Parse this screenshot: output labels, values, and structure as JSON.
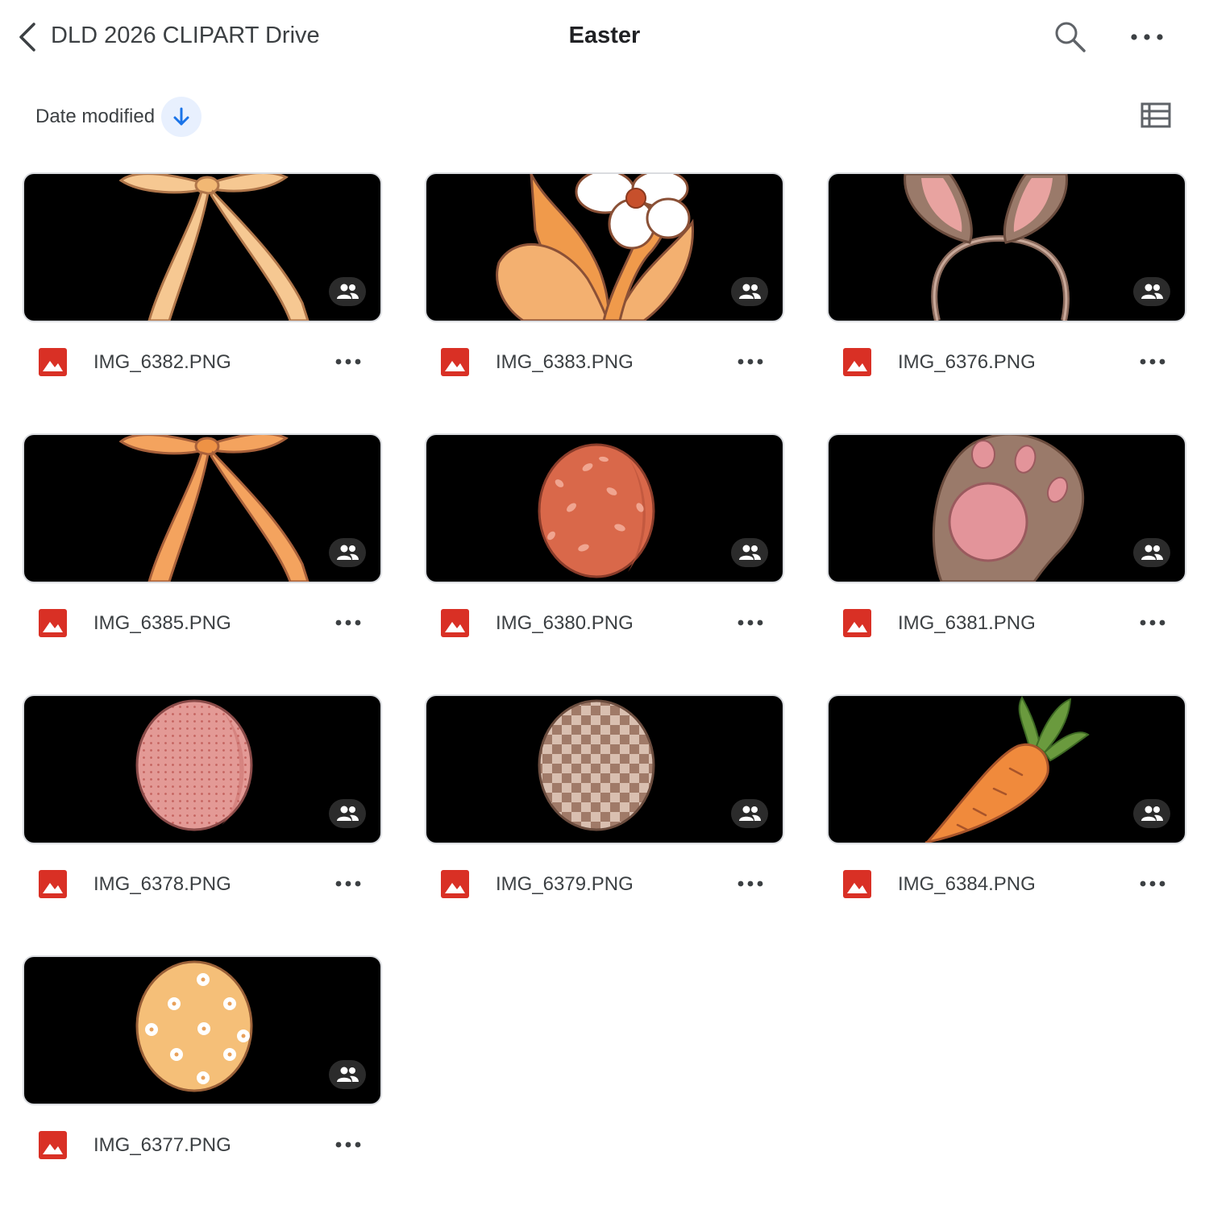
{
  "header": {
    "back_label": "DLD 2026 CLIPART Drive",
    "title": "Easter",
    "icons": [
      "chevron-left-icon",
      "search-icon",
      "more-horiz-icon"
    ]
  },
  "toolbar": {
    "sort_label": "Date modified",
    "sort_icon": "arrow-down-icon",
    "view_icon": "list-view-icon"
  },
  "files": [
    {
      "name": "IMG_6382.PNG",
      "thumbnail": "ribbon-bow",
      "shared": true
    },
    {
      "name": "IMG_6383.PNG",
      "thumbnail": "flower",
      "shared": true
    },
    {
      "name": "IMG_6376.PNG",
      "thumbnail": "bunny-ears-headband",
      "shared": true
    },
    {
      "name": "IMG_6385.PNG",
      "thumbnail": "ribbon-bow",
      "shared": true
    },
    {
      "name": "IMG_6380.PNG",
      "thumbnail": "leaf-pattern-egg",
      "shared": true
    },
    {
      "name": "IMG_6381.PNG",
      "thumbnail": "bunny-paw",
      "shared": true
    },
    {
      "name": "IMG_6378.PNG",
      "thumbnail": "polka-dot-egg",
      "shared": true
    },
    {
      "name": "IMG_6379.PNG",
      "thumbnail": "checkered-egg",
      "shared": true
    },
    {
      "name": "IMG_6384.PNG",
      "thumbnail": "carrot",
      "shared": true
    },
    {
      "name": "IMG_6377.PNG",
      "thumbnail": "flower-egg",
      "shared": true
    }
  ],
  "colors": {
    "image_type_icon": "#d93025",
    "sort_accent": "#1a73e8",
    "sort_bg": "#e8f0fe",
    "thumbnail_bg": "#000000"
  }
}
